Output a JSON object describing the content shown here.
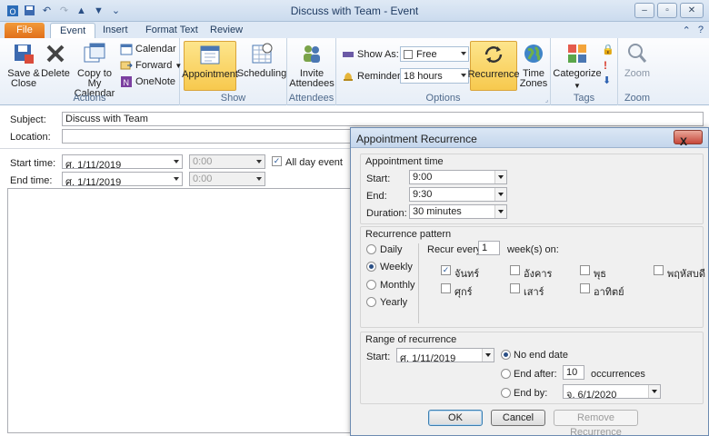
{
  "window": {
    "title": "Discuss with Team - Event"
  },
  "tabs": [
    "File",
    "Event",
    "Insert",
    "Format Text",
    "Review"
  ],
  "ribbon": {
    "actions": {
      "save_close": "Save & Close",
      "delete": "Delete",
      "copy_calendar": "Copy to My Calendar",
      "calendar": "Calendar",
      "forward": "Forward",
      "onenote": "OneNote",
      "label": "Actions"
    },
    "show": {
      "appointment": "Appointment",
      "scheduling": "Scheduling",
      "label": "Show"
    },
    "attendees": {
      "invite": "Invite Attendees",
      "label": "Attendees"
    },
    "options": {
      "show_as_label": "Show As:",
      "show_as_value": "Free",
      "reminder_label": "Reminder:",
      "reminder_value": "18 hours",
      "recurrence": "Recurrence",
      "time_zones": "Time Zones",
      "label": "Options"
    },
    "tags": {
      "categorize": "Categorize",
      "label": "Tags"
    },
    "zoom": {
      "zoom": "Zoom",
      "label": "Zoom"
    }
  },
  "form": {
    "subject_label": "Subject:",
    "subject_value": "Discuss with Team",
    "location_label": "Location:",
    "location_value": "",
    "start_label": "Start time:",
    "start_date": "ศ. 1/11/2019",
    "start_time": "0:00",
    "end_label": "End time:",
    "end_date": "ศ. 1/11/2019",
    "end_time": "0:00",
    "all_day_label": "All day event"
  },
  "dialog": {
    "title": "Appointment Recurrence",
    "close_glyph": "X",
    "appointment_time": {
      "label": "Appointment time",
      "start_label": "Start:",
      "start_value": "9:00",
      "end_label": "End:",
      "end_value": "9:30",
      "duration_label": "Duration:",
      "duration_value": "30 minutes"
    },
    "pattern": {
      "label": "Recurrence pattern",
      "options": [
        "Daily",
        "Weekly",
        "Monthly",
        "Yearly"
      ],
      "selected": "Weekly",
      "recur_every_label": "Recur every",
      "recur_every_value": "1",
      "weeks_on_label": "week(s) on:",
      "days": [
        {
          "name": "จันทร์",
          "checked": true
        },
        {
          "name": "อังคาร",
          "checked": false
        },
        {
          "name": "พุธ",
          "checked": false
        },
        {
          "name": "พฤหัสบดี",
          "checked": false
        },
        {
          "name": "ศุกร์",
          "checked": false
        },
        {
          "name": "เสาร์",
          "checked": false
        },
        {
          "name": "อาทิตย์",
          "checked": false
        }
      ]
    },
    "range": {
      "label": "Range of recurrence",
      "start_label": "Start:",
      "start_value": "ศ. 1/11/2019",
      "no_end": "No end date",
      "end_after": "End after:",
      "end_after_value": "10",
      "occurrences": "occurrences",
      "end_by": "End by:",
      "end_by_value": "จ. 6/1/2020",
      "selected": "No end date"
    },
    "buttons": {
      "ok": "OK",
      "cancel": "Cancel",
      "remove": "Remove Recurrence"
    }
  },
  "colors": {
    "accent_orange": "#e1701a",
    "selected_yellow": "#f7c94e",
    "ribbon_blue": "#dfe9f5"
  }
}
